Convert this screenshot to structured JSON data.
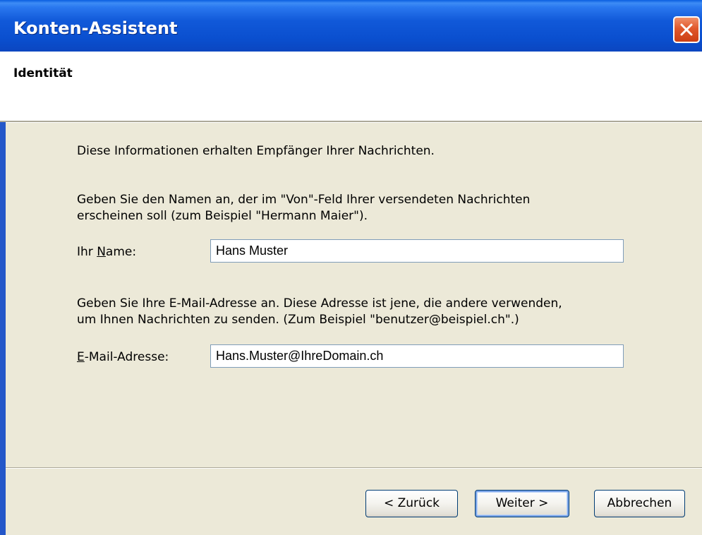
{
  "window": {
    "title": "Konten-Assistent"
  },
  "page": {
    "heading": "Identität",
    "intro": "Diese Informationen erhalten Empfänger Ihrer Nachrichten.",
    "name_instructions": [
      "Geben Sie den Namen an, der im \"Von\"-Feld Ihrer versendeten Nachrichten",
      "erscheinen soll (zum Beispiel \"Hermann Maier\")."
    ],
    "name_label_prefix": "Ihr ",
    "name_label_accel": "N",
    "name_label_suffix": "ame:",
    "name_value": "Hans Muster",
    "email_instructions": [
      "Geben Sie Ihre E-Mail-Adresse an. Diese Adresse ist jene, die andere verwenden,",
      "um Ihnen Nachrichten zu senden. (Zum Beispiel \"benutzer@beispiel.ch\".)"
    ],
    "email_label_accel": "E",
    "email_label_suffix": "-Mail-Adresse:",
    "email_value": "Hans.Muster@IhreDomain.ch"
  },
  "buttons": {
    "back": "< Zurück",
    "next": "Weiter >",
    "cancel": "Abbrechen"
  },
  "icons": {
    "close": "close-icon"
  },
  "colors": {
    "titlebar": "#0a4fcf",
    "dialog_background": "#ece9d8",
    "close_button": "#e0582c",
    "field_border": "#7f9db9"
  }
}
